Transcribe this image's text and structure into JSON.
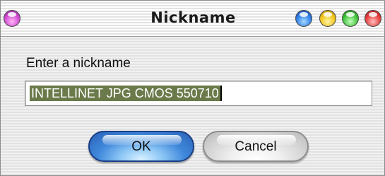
{
  "window": {
    "title": "Nickname"
  },
  "titlebar": {
    "left_button_icon": "purple-orb-icon",
    "right_button_icons": [
      "blue-orb-icon",
      "yellow-orb-icon",
      "green-orb-icon",
      "red-orb-icon"
    ]
  },
  "dialog": {
    "prompt": "Enter a nickname",
    "nickname_value": "INTELLINET JPG CMOS 550710",
    "ok_label": "OK",
    "cancel_label": "Cancel"
  },
  "colors": {
    "selection": "#6b7a4a",
    "ok_button": "#3f88db"
  }
}
